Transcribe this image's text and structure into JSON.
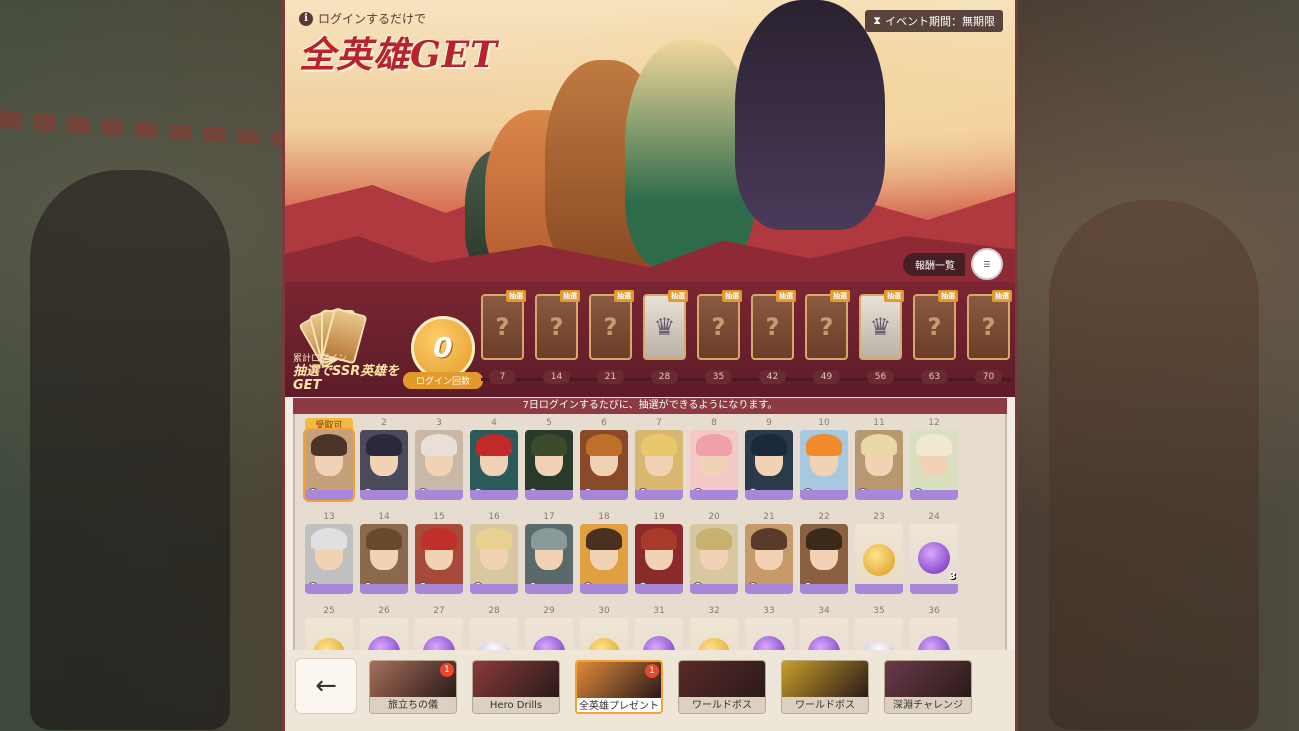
{
  "header": {
    "info_text": "ログインするだけで",
    "title": "全英雄GET",
    "event_period_icon": "hourglass-icon",
    "event_period": "イベント期間：無期限",
    "reward_list_label": "報酬一覧"
  },
  "progress": {
    "ssr_small": "累計ログイン",
    "ssr_big": "抽選でSSR英雄をGET",
    "login_count": "0",
    "login_count_label": "ログイン回数",
    "milestones": [
      {
        "day": "7",
        "tag": "抽選",
        "type": "mystery"
      },
      {
        "day": "14",
        "tag": "抽選",
        "type": "mystery"
      },
      {
        "day": "21",
        "tag": "抽選",
        "type": "mystery"
      },
      {
        "day": "28",
        "tag": "抽選",
        "type": "hero"
      },
      {
        "day": "35",
        "tag": "抽選",
        "type": "mystery"
      },
      {
        "day": "42",
        "tag": "抽選",
        "type": "mystery"
      },
      {
        "day": "49",
        "tag": "抽選",
        "type": "mystery"
      },
      {
        "day": "56",
        "tag": "抽選",
        "type": "hero"
      },
      {
        "day": "63",
        "tag": "抽選",
        "type": "mystery"
      },
      {
        "day": "70",
        "tag": "抽選",
        "type": "mystery"
      }
    ]
  },
  "notice": "7日ログインするたびに、抽選ができるようになります。",
  "grid": {
    "rows": [
      [
        {
          "num": "受取可",
          "kind": "hero",
          "hair": "#4a3428",
          "bg": "#c6a07a",
          "claimed": true
        },
        {
          "num": "2",
          "kind": "hero",
          "hair": "#2a2a3a",
          "bg": "#4a4a5a"
        },
        {
          "num": "3",
          "kind": "hero",
          "hair": "#e8e0d8",
          "bg": "#c9b8a8"
        },
        {
          "num": "4",
          "kind": "hero",
          "hair": "#c02a2a",
          "bg": "#2a5a5a"
        },
        {
          "num": "5",
          "kind": "hero",
          "hair": "#3a4a2a",
          "bg": "#2a3a2a"
        },
        {
          "num": "6",
          "kind": "hero",
          "hair": "#c0702a",
          "bg": "#8a4a2a"
        },
        {
          "num": "7",
          "kind": "hero",
          "hair": "#e8c86a",
          "bg": "#d8b870"
        },
        {
          "num": "8",
          "kind": "hero",
          "hair": "#f0a0a8",
          "bg": "#f5c8c8"
        },
        {
          "num": "9",
          "kind": "hero",
          "hair": "#1a2a3a",
          "bg": "#2a3a4a"
        },
        {
          "num": "10",
          "kind": "hero",
          "hair": "#f08a2a",
          "bg": "#a8c8e0"
        },
        {
          "num": "11",
          "kind": "hero",
          "hair": "#e8d8a8",
          "bg": "#b89870"
        },
        {
          "num": "12",
          "kind": "hero",
          "hair": "#f0e8d0",
          "bg": "#d8e0c0"
        }
      ],
      [
        {
          "num": "13",
          "kind": "hero",
          "hair": "#e0e0e0",
          "bg": "#c0c0c0"
        },
        {
          "num": "14",
          "kind": "hero",
          "hair": "#6a4a2a",
          "bg": "#8a6a4a"
        },
        {
          "num": "15",
          "kind": "hero",
          "hair": "#c0302a",
          "bg": "#a84a3a"
        },
        {
          "num": "16",
          "kind": "hero",
          "hair": "#e8d090",
          "bg": "#d8c8a0"
        },
        {
          "num": "17",
          "kind": "hero",
          "hair": "#8a9a9a",
          "bg": "#5a6a6a"
        },
        {
          "num": "18",
          "kind": "hero",
          "hair": "#4a3020",
          "bg": "#e0a040"
        },
        {
          "num": "19",
          "kind": "hero",
          "hair": "#a83a2a",
          "bg": "#8a2a2a"
        },
        {
          "num": "20",
          "kind": "hero",
          "hair": "#c8b070",
          "bg": "#d8c8a0"
        },
        {
          "num": "21",
          "kind": "hero",
          "hair": "#5a3a2a",
          "bg": "#c89a6a"
        },
        {
          "num": "22",
          "kind": "hero",
          "hair": "#3a2a1a",
          "bg": "#8a6040"
        },
        {
          "num": "23",
          "kind": "gold"
        },
        {
          "num": "24",
          "kind": "orb",
          "count": "3"
        }
      ],
      [
        {
          "num": "25",
          "kind": "gold"
        },
        {
          "num": "26",
          "kind": "orb"
        },
        {
          "num": "27",
          "kind": "orb"
        },
        {
          "num": "28",
          "kind": "crystal"
        },
        {
          "num": "29",
          "kind": "orb"
        },
        {
          "num": "30",
          "kind": "gold"
        },
        {
          "num": "31",
          "kind": "orb"
        },
        {
          "num": "32",
          "kind": "gold"
        },
        {
          "num": "33",
          "kind": "orb"
        },
        {
          "num": "34",
          "kind": "orb"
        },
        {
          "num": "35",
          "kind": "crystal"
        },
        {
          "num": "36",
          "kind": "orb"
        }
      ]
    ]
  },
  "bottom_nav": {
    "back_icon": "back-arrow-icon",
    "back_glyph": "←",
    "tabs": [
      {
        "label": "旅立ちの儀",
        "color": "#a8705a",
        "dot": "1",
        "active": false
      },
      {
        "label": "Hero Drills",
        "color": "#8a3a3a",
        "dot": "",
        "active": false
      },
      {
        "label": "全英雄プレゼント",
        "color": "#e08a3a",
        "dot": "1",
        "active": true
      },
      {
        "label": "ワールドボス",
        "color": "#5a2a2a",
        "dot": "",
        "active": false
      },
      {
        "label": "ワールドボス",
        "color": "#c8a02a",
        "dot": "",
        "active": false
      },
      {
        "label": "深淵チャレンジ",
        "color": "#6a3a4a",
        "dot": "",
        "active": false
      }
    ]
  }
}
